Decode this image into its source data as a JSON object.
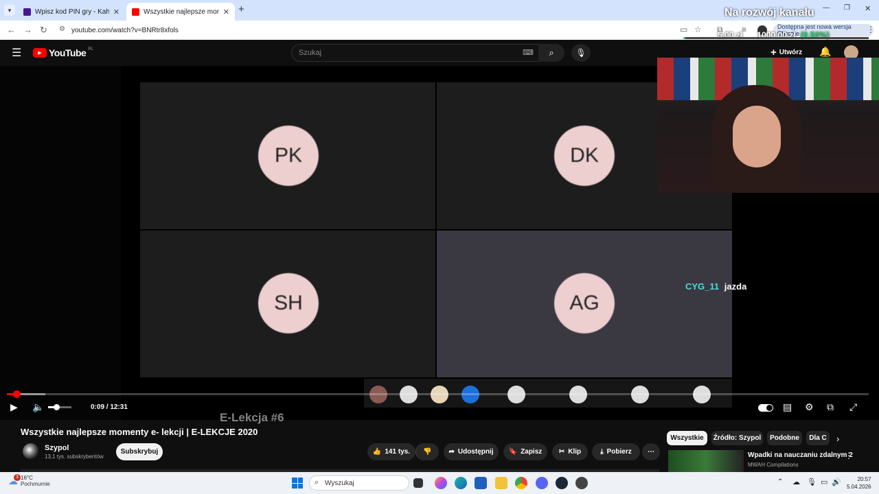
{
  "browser": {
    "tabs": [
      {
        "label": "Wpisz kod PIN gry - Kahoot!",
        "active": false,
        "color": "#46178f"
      },
      {
        "label": "Wszystkie najlepsze momenty e",
        "active": true,
        "color": "#ff0000"
      }
    ],
    "new_tab": "+",
    "url": "youtube.com/watch?v=BNRtr8xfols",
    "update_notice": "Dostępna jest nowa wersja Chrome",
    "overlay_title": "Na rozwój kanału",
    "overlay_amounts": [
      "5,00 zł",
      "1000,00 zł",
      "(0,50%)"
    ]
  },
  "youtube": {
    "logo": "YouTube",
    "region": "PL",
    "search_placeholder": "Szukaj",
    "create_label": "Utwórz"
  },
  "video": {
    "participants": [
      "PK",
      "DK",
      "SH",
      "AG"
    ],
    "chat_user": "CYG_11",
    "chat_message": "jazda",
    "slide_text": "E-Lekcja #6",
    "time": "0:09 / 12:31",
    "progress_fraction": 0.012
  },
  "meta": {
    "title": "Wszystkie najlepsze momenty e- lekcji | E-LEKCJE 2020",
    "channel": "Szypol",
    "subscribers": "13,1 tys. subskrybentów",
    "subscribe": "Subskrybuj",
    "likes": "141 tys.",
    "share": "Udostępnij",
    "save": "Zapisz",
    "clip": "Klip",
    "download": "Pobierz"
  },
  "sidebar": {
    "chips": [
      "Wszystkie",
      "Źródło: Szypol",
      "Podobne",
      "Dla C"
    ],
    "rec_title": "Wpadki na nauczaniu zdalnym 2",
    "rec_channel": "MWAH Compilations"
  },
  "taskbar": {
    "temp": "16°C",
    "weather": "Pochmurnie",
    "weather_badge": "3",
    "search": "Wyszukaj",
    "time": "20:57",
    "date": "5.04.2026"
  }
}
